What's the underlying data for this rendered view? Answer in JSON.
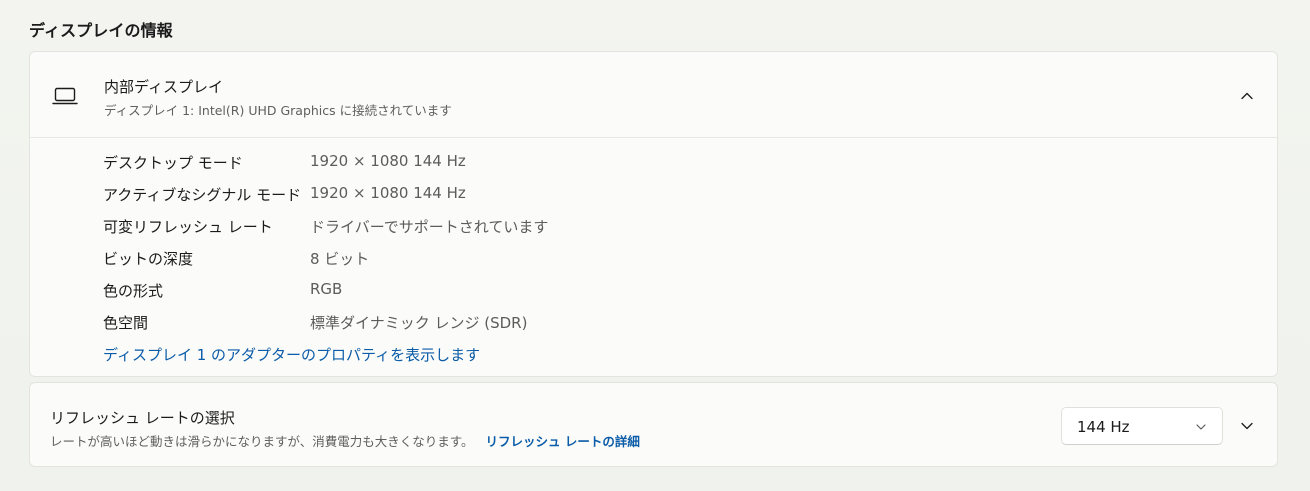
{
  "section": {
    "title": "ディスプレイの情報"
  },
  "display_card": {
    "icon": "laptop-icon",
    "title": "内部ディスプレイ",
    "subtitle": "ディスプレイ 1: Intel(R) UHD Graphics に接続されています",
    "collapse_icon": "chevron-up-icon",
    "rows": [
      {
        "label": "デスクトップ モード",
        "value": "1920 × 1080 144 Hz"
      },
      {
        "label": "アクティブなシグナル モード",
        "value": "1920 × 1080 144 Hz"
      },
      {
        "label": "可変リフレッシュ レート",
        "value": "ドライバーでサポートされています"
      },
      {
        "label": "ビットの深度",
        "value": "8 ビット"
      },
      {
        "label": "色の形式",
        "value": "RGB"
      },
      {
        "label": "色空間",
        "value": "標準ダイナミック レンジ (SDR)"
      }
    ],
    "adapter_link": "ディスプレイ 1 のアダプターのプロパティを表示します"
  },
  "refresh_card": {
    "title": "リフレッシュ レートの選択",
    "subtitle": "レートが高いほど動きは滑らかになりますが、消費電力も大きくなります。",
    "details_link": "リフレッシュ レートの詳細",
    "dropdown_value": "144 Hz",
    "dropdown_icon": "chevron-down-icon",
    "expand_icon": "chevron-down-icon"
  },
  "colors": {
    "link": "#0b5ca8",
    "card_bg": "#fbfbf9",
    "page_bg": "#f1f3ee"
  }
}
